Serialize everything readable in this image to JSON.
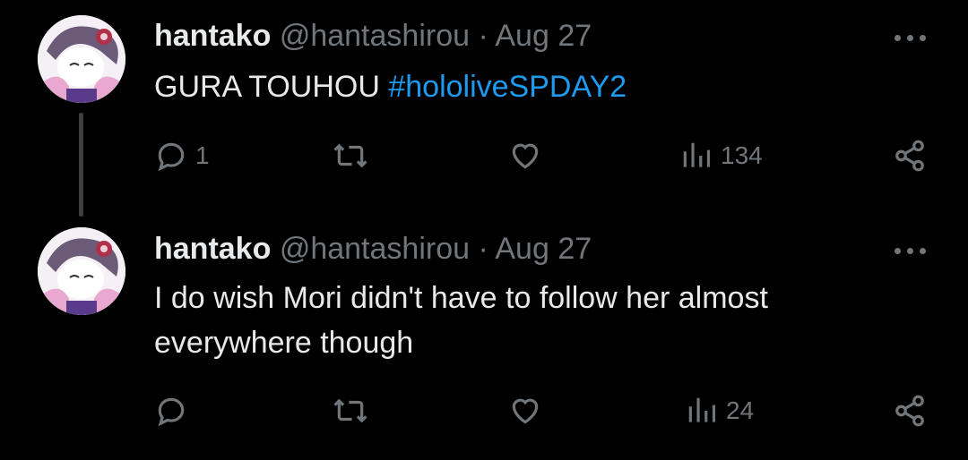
{
  "tweets": [
    {
      "name": "hantako",
      "handle": "@hantashirou",
      "separator": "·",
      "date": "Aug 27",
      "text_plain": "GURA TOUHOU ",
      "hashtag": "#hololiveSPDAY2",
      "replies": "1",
      "retweets": "",
      "likes": "",
      "views": "134"
    },
    {
      "name": "hantako",
      "handle": "@hantashirou",
      "separator": "·",
      "date": "Aug 27",
      "text_line1": "I do wish Mori didn't have to follow her almost",
      "text_line2": "everywhere though",
      "replies": "",
      "retweets": "",
      "likes": "",
      "views": "24"
    }
  ],
  "icons": [
    "reply-icon",
    "retweet-icon",
    "like-icon",
    "views-icon",
    "share-icon",
    "more-icon"
  ],
  "colors": {
    "background": "#000000",
    "text": "#e7e9ea",
    "muted": "#71767b",
    "link": "#1d9bf0"
  }
}
